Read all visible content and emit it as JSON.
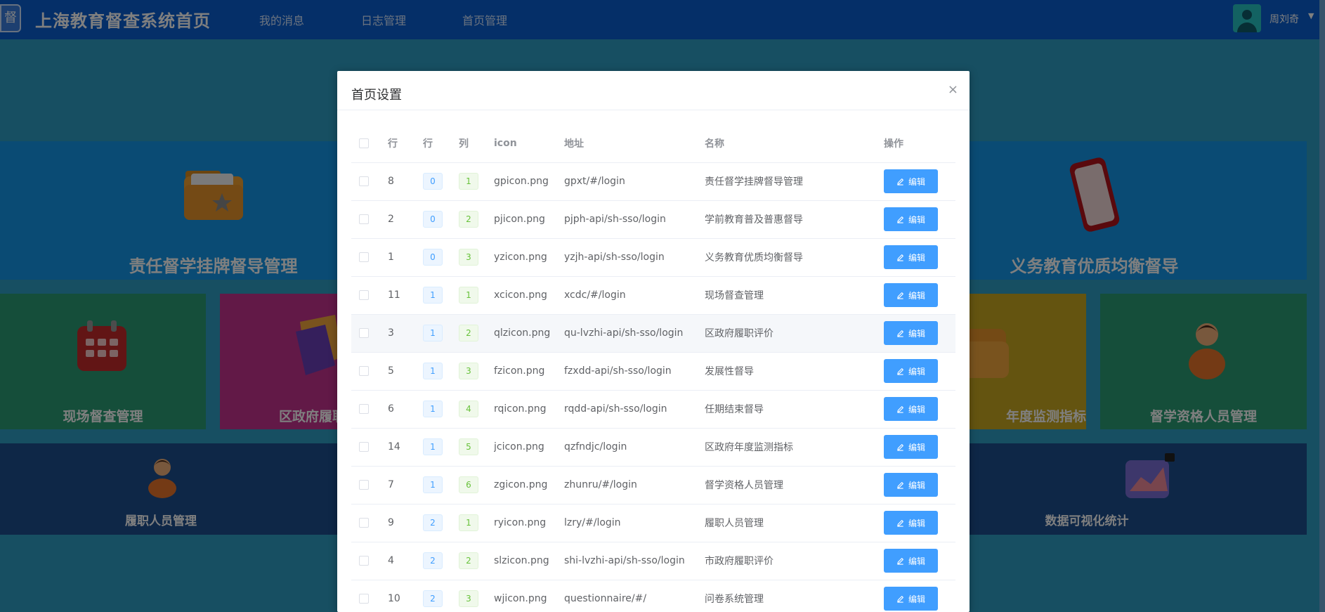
{
  "app": {
    "logo_char": "督",
    "title": "上海教育督查系统首页",
    "nav": [
      "我的消息",
      "日志管理",
      "首页管理"
    ],
    "user_name": "周刘奇"
  },
  "tiles": [
    {
      "label": "责任督学挂牌督导管理",
      "color": "#1597e8",
      "icon": "folder-star-icon"
    },
    {
      "label": "义务教育优质均衡督导",
      "color": "#1597e8",
      "icon": "phone-icon"
    },
    {
      "label": "现场督查管理",
      "color": "#2a9d75",
      "icon": "calendar-icon"
    },
    {
      "label": "区政府履职评价",
      "color": "#c4338f",
      "icon": "document-icon"
    },
    {
      "label": "年度监测指标",
      "color": "#c8a821",
      "icon": "folder-icon"
    },
    {
      "label": "督学资格人员管理",
      "color": "#2a9d75",
      "icon": "person-icon"
    },
    {
      "label": "履职人员管理",
      "color": "#1d4f8e",
      "icon": "person-icon"
    },
    {
      "label": "数据可视化统计",
      "color": "#1d4f8e",
      "icon": "chart-icon"
    }
  ],
  "dialog": {
    "title": "首页设置",
    "close_icon": "×",
    "columns": [
      "行",
      "行",
      "列",
      "icon",
      "地址",
      "名称",
      "操作"
    ],
    "edit_label": "编辑",
    "rows": [
      {
        "id": "8",
        "row": "0",
        "col": "1",
        "icon": "gpicon.png",
        "address": "gpxt/#/login",
        "name": "责任督学挂牌督导管理"
      },
      {
        "id": "2",
        "row": "0",
        "col": "2",
        "icon": "pjicon.png",
        "address": "pjph-api/sh-sso/login",
        "name": "学前教育普及普惠督导"
      },
      {
        "id": "1",
        "row": "0",
        "col": "3",
        "icon": "yzicon.png",
        "address": "yzjh-api/sh-sso/login",
        "name": "义务教育优质均衡督导"
      },
      {
        "id": "11",
        "row": "1",
        "col": "1",
        "icon": "xcicon.png",
        "address": "xcdc/#/login",
        "name": "现场督查管理"
      },
      {
        "id": "3",
        "row": "1",
        "col": "2",
        "icon": "qlzicon.png",
        "address": "qu-lvzhi-api/sh-sso/login",
        "name": "区政府履职评价",
        "highlight": true
      },
      {
        "id": "5",
        "row": "1",
        "col": "3",
        "icon": "fzicon.png",
        "address": "fzxdd-api/sh-sso/login",
        "name": "发展性督导"
      },
      {
        "id": "6",
        "row": "1",
        "col": "4",
        "icon": "rqicon.png",
        "address": "rqdd-api/sh-sso/login",
        "name": "任期结束督导"
      },
      {
        "id": "14",
        "row": "1",
        "col": "5",
        "icon": "jcicon.png",
        "address": "qzfndjc/login",
        "name": "区政府年度监测指标"
      },
      {
        "id": "7",
        "row": "1",
        "col": "6",
        "icon": "zgicon.png",
        "address": "zhunru/#/login",
        "name": "督学资格人员管理"
      },
      {
        "id": "9",
        "row": "2",
        "col": "1",
        "icon": "ryicon.png",
        "address": "lzry/#/login",
        "name": "履职人员管理"
      },
      {
        "id": "4",
        "row": "2",
        "col": "2",
        "icon": "slzicon.png",
        "address": "shi-lvzhi-api/sh-sso/login",
        "name": "市政府履职评价"
      },
      {
        "id": "10",
        "row": "2",
        "col": "3",
        "icon": "wjicon.png",
        "address": "questionnaire/#/",
        "name": "问卷系统管理"
      }
    ]
  }
}
